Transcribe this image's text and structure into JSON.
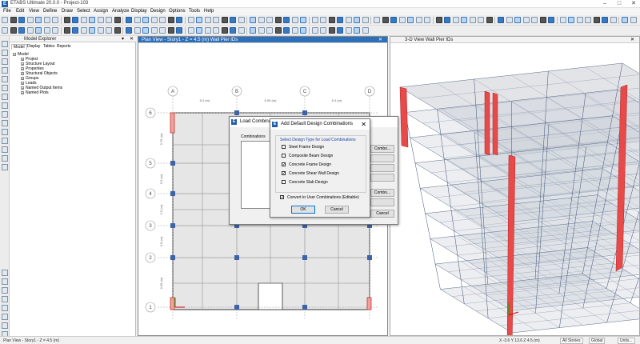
{
  "app": {
    "title": "ETABS Ultimate 20.0.0 - Project-103",
    "logo": "E"
  },
  "menu": [
    "File",
    "Edit",
    "View",
    "Define",
    "Draw",
    "Select",
    "Assign",
    "Analyze",
    "Display",
    "Design",
    "Options",
    "Tools",
    "Help"
  ],
  "explorer": {
    "title": "Model Explorer",
    "tabs": [
      "Model",
      "Display",
      "Tables",
      "Reports"
    ],
    "root": "Model",
    "items": [
      "Project",
      "Structure Layout",
      "Properties",
      "Structural Objects",
      "Groups",
      "Loads",
      "Named Output Items",
      "Named Plots"
    ]
  },
  "plan_view": {
    "title": "Plan View - Story1 - Z = 4.5 (m)  Wall Pier IDs",
    "col_bubbles": [
      "A",
      "B",
      "C",
      "D"
    ],
    "row_bubbles": [
      "6",
      "5",
      "4",
      "3",
      "2",
      "1"
    ],
    "dims_top": [
      "6.4 (m)",
      "6.55 (m)",
      "6.4 (m)"
    ],
    "dims_left": [
      "3.75 (m)",
      "3.5 (m)",
      "2.5 (m)",
      "3.5 (m)",
      "4.65 (m)"
    ]
  },
  "view3d": {
    "title": "3-D View  Wall Pier IDs"
  },
  "load_combo_dialog": {
    "title": "Load Combinations",
    "group_label": "Combinations",
    "buttons": [
      "Combo...",
      "Combo...",
      "OK",
      "Cancel"
    ]
  },
  "design_combo_dialog": {
    "title": "Add Default Design Combinations",
    "group_label": "Select Design Type for Load Combinations",
    "options": [
      {
        "label": "Steel Frame Design",
        "checked": false
      },
      {
        "label": "Composite Beam Design",
        "checked": false
      },
      {
        "label": "Concrete Frame Design",
        "checked": true
      },
      {
        "label": "Concrete Shear Wall Design",
        "checked": true
      },
      {
        "label": "Concrete Slab Design",
        "checked": false
      }
    ],
    "convert_label": "Convert to User Combinations (Editable)",
    "convert_checked": true,
    "ok": "OK",
    "cancel": "Cancel"
  },
  "status": {
    "left": "Plan View - Story1 - Z = 4.5 (m)",
    "coords": "X -3.6  Y 13.6  Z 4.5 (m)",
    "stories": "All Stories",
    "global": "Global",
    "units": "Units..."
  }
}
